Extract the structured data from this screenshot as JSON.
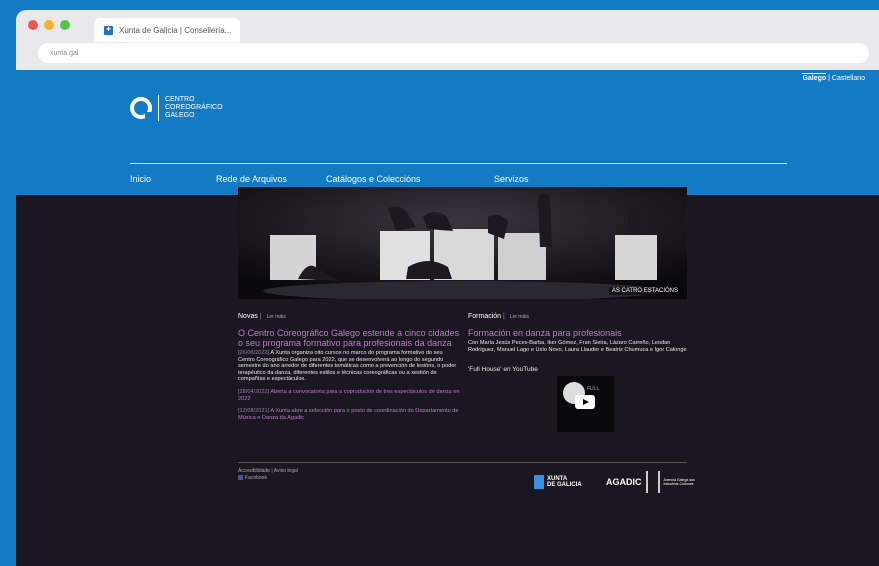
{
  "browser": {
    "tab_title": "Xunta de Galicia | Consellería...",
    "url": "xunta.gal",
    "dot_colors": [
      "#e8595a",
      "#f2b42f",
      "#57c34a"
    ]
  },
  "header": {
    "lang_active": "Galego",
    "lang_sep": "|",
    "lang_other": "Castellano",
    "logo_line1": "CENTRO",
    "logo_line2": "COREOGRÁFICO",
    "logo_line3": "GALEGO",
    "nav": [
      "Inicio",
      "Rede de Arquivos",
      "Catálogos e Coleccións",
      "Servizos"
    ]
  },
  "hero": {
    "caption": "AS CATRO ESTACIÓNS"
  },
  "novas": {
    "title": "Novas",
    "sep": "|",
    "more": "Ler máis",
    "headline": "O Centro Coreográfico Galego estende a cinco cidades o seu programa formativo para profesionais da danza",
    "date": "[26/06/2022]",
    "summary": "A Xunta organiza oito cursos no marco do programa formativo do seu Centro Coreográfico Galego para 2022, que se desenvolverá ao longo do segundo semestre do ano arredor de diferentes temáticas como a prevención de lesións, o poder terapéutico da danza, diferentes estilos e técnicas coreográficas ou a xestión de compañías e espectáculos.",
    "items": [
      {
        "date": "[28/04/2022]",
        "text": "Aberta a convocatoria para a coprodución de tres espectáculos de danza en 2022"
      },
      {
        "date": "[12/08/2021]",
        "text": "A Xunta abre a selección para o posto de coordinación do Departamento de Música e Danza da Agadic"
      }
    ]
  },
  "formacion": {
    "title": "Formación",
    "sep": "|",
    "more": "Ler máis",
    "headline": "Formación en danza para profesionais",
    "summary": "Con María Jesús Peces-Barba, Iker Gómez, Fran Sieira, Lázaro Carreño, Leodan Rodríguez, Manuel Lago e Uxío Novo, Laura Llauder e Beatriz Chumuca e Igor Calonge",
    "youtube_label": "'Full House' en YouTube",
    "youtube_overlay": "FULL"
  },
  "footer": {
    "accessibility": "Accesibilidade",
    "sep": "|",
    "legal": "Aviso legal",
    "facebook": "Facebook",
    "xunta_line1": "XUNTA",
    "xunta_line2": "DE GALICIA",
    "agadic": "AGADIC",
    "agadic_sub": "Axencia Galega das Industrias Culturais"
  }
}
